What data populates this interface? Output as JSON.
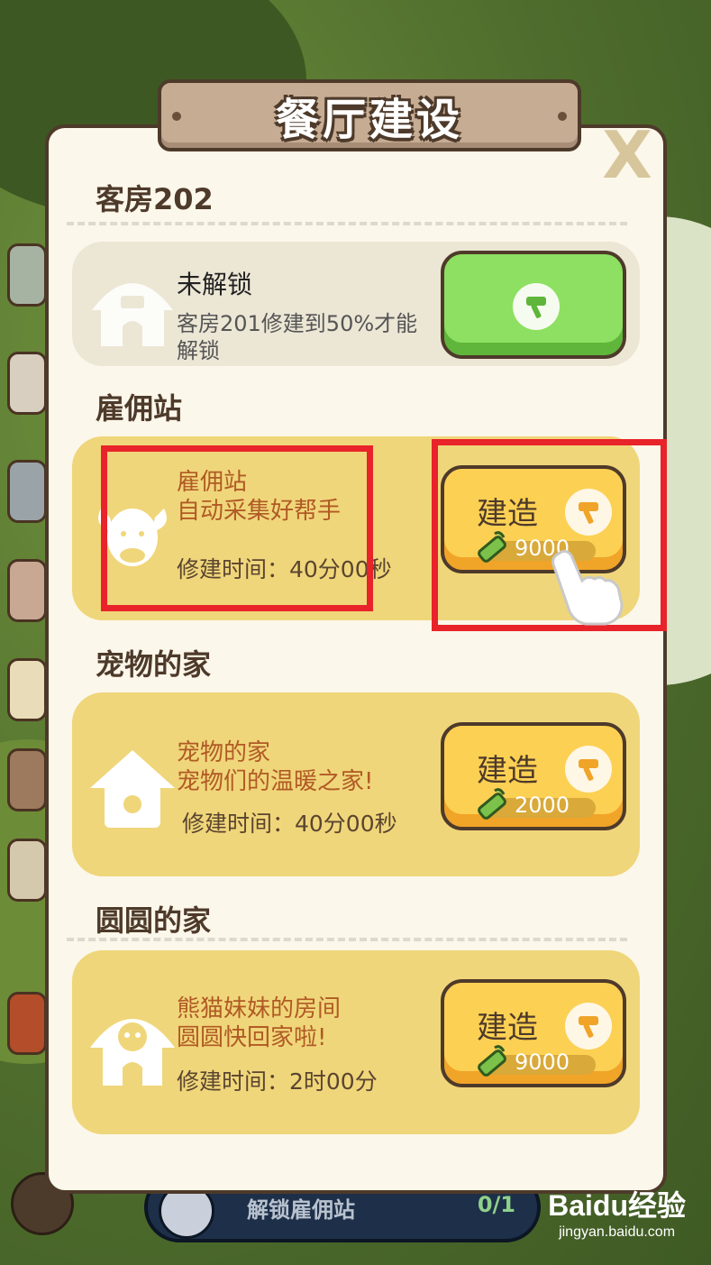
{
  "dialog": {
    "title": "餐厅建设",
    "close_symbol": "X"
  },
  "sections": [
    {
      "heading": "客房202",
      "locked": true,
      "status": "未解锁",
      "requirement": "客房201修建到50%才能解锁",
      "icon": "house-icon"
    },
    {
      "heading": "雇佣站",
      "name": "雇佣站",
      "description": "自动采集好帮手",
      "build_time": "修建时间：40分00秒",
      "button_label": "建造",
      "cost": "9000",
      "icon": "bull-head-icon"
    },
    {
      "heading": "宠物的家",
      "name": "宠物的家",
      "description": "宠物们的温暖之家!",
      "build_time": "修建时间：40分00秒",
      "button_label": "建造",
      "cost": "2000",
      "icon": "birdhouse-icon"
    },
    {
      "heading": "圆圆的家",
      "name": "熊猫妹妹的房间",
      "description": "圆圆快回家啦!",
      "build_time": "修建时间：2时00分",
      "button_label": "建造",
      "cost": "9000",
      "icon": "panda-house-icon"
    }
  ],
  "background": {
    "task_label": "解锁雇佣站",
    "task_count": "0/1"
  },
  "watermark": {
    "logo": "Baidu经验",
    "url": "jingyan.baidu.com"
  },
  "colors": {
    "modal_bg": "#fbf7ea",
    "card_open": "#f0d67a",
    "card_locked": "#ece6d5",
    "button_green": "#8de061",
    "button_yellow": "#fcd053",
    "highlight_red": "#e8232a",
    "text_brown": "#4e3a2a",
    "text_orange": "#b05a25"
  }
}
